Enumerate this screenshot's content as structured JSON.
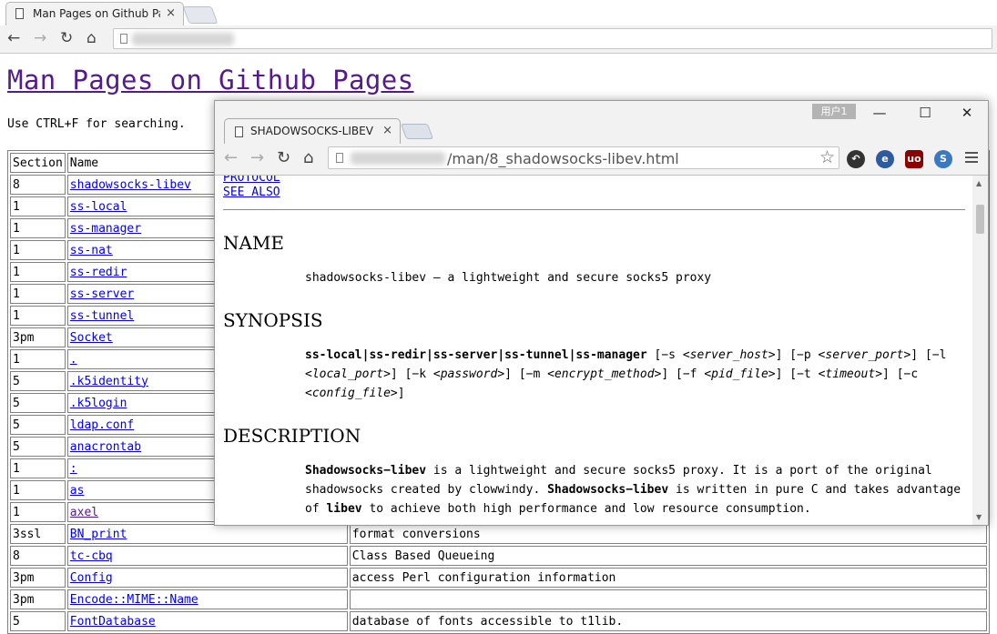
{
  "back_browser": {
    "tab_title": "Man Pages on Github Pa",
    "tab_close": "×",
    "nav": {
      "back": "←",
      "forward": "→",
      "reload": "↻",
      "home": "⌂"
    }
  },
  "page": {
    "title": "Man Pages on Github Pages",
    "hint": "Use CTRL+F for searching.",
    "table_header": {
      "section": "Section",
      "name": "Name",
      "desc": ""
    },
    "rows": [
      {
        "section": "8",
        "name": "shadowsocks-libev",
        "desc": "",
        "visited": false
      },
      {
        "section": "1",
        "name": "ss-local",
        "desc": "",
        "visited": false
      },
      {
        "section": "1",
        "name": "ss-manager",
        "desc": "",
        "visited": false
      },
      {
        "section": "1",
        "name": "ss-nat",
        "desc": "",
        "visited": false
      },
      {
        "section": "1",
        "name": "ss-redir",
        "desc": "",
        "visited": false
      },
      {
        "section": "1",
        "name": "ss-server",
        "desc": "",
        "visited": false
      },
      {
        "section": "1",
        "name": "ss-tunnel",
        "desc": "",
        "visited": false
      },
      {
        "section": "3pm",
        "name": "Socket",
        "desc": "",
        "visited": false
      },
      {
        "section": "1",
        "name": ".",
        "desc": "",
        "visited": false
      },
      {
        "section": "5",
        "name": ".k5identity",
        "desc": "",
        "visited": false
      },
      {
        "section": "5",
        "name": ".k5login",
        "desc": "",
        "visited": false
      },
      {
        "section": "5",
        "name": "ldap.conf",
        "desc": "",
        "visited": false
      },
      {
        "section": "5",
        "name": "anacrontab",
        "desc": "",
        "visited": false
      },
      {
        "section": "1",
        "name": ":",
        "desc": "",
        "visited": false
      },
      {
        "section": "1",
        "name": "as",
        "desc": "",
        "visited": false
      },
      {
        "section": "1",
        "name": "axel",
        "desc": "",
        "visited": true
      },
      {
        "section": "3ssl",
        "name": "BN_print",
        "desc": "format conversions",
        "visited": false
      },
      {
        "section": "8",
        "name": "tc-cbq",
        "desc": "Class Based Queueing",
        "visited": false
      },
      {
        "section": "3pm",
        "name": "Config",
        "desc": "access Perl configuration information",
        "visited": false
      },
      {
        "section": "3pm",
        "name": "Encode::MIME::Name",
        "desc": "",
        "visited": false
      },
      {
        "section": "5",
        "name": "FontDatabase",
        "desc": "database of fonts accessible to t1lib.",
        "visited": false
      }
    ]
  },
  "popup": {
    "user_badge": "用户1",
    "window_controls": {
      "minimize": "—",
      "maximize": "☐",
      "close": "✕"
    },
    "tab_title": "SHADOWSOCKS-LIBEV",
    "tab_close": "×",
    "url_path": "/man/8_shadowsocks-libev.html",
    "star": "☆",
    "extensions": [
      {
        "name": "history-extension-icon",
        "glyph": "↶",
        "color": "#333333"
      },
      {
        "name": "e-extension-icon",
        "glyph": "e",
        "color": "#2d5aa0"
      },
      {
        "name": "ublock-extension-icon",
        "glyph": "uo",
        "color": "#8b0000"
      },
      {
        "name": "translate-extension-icon",
        "glyph": "S",
        "color": "#3a78c4"
      }
    ],
    "content": {
      "links": [
        "PROTOCOL",
        "SEE ALSO"
      ],
      "name_heading": "NAME",
      "name_text": "shadowsocks-libev — a lightweight and secure socks5 proxy",
      "synopsis_heading": "SYNOPSIS",
      "synopsis": {
        "cmd": "ss-local|ss-redir|ss-server|ss-tunnel|ss-manager",
        "o1": " [−s ",
        "a1": "<server_host>",
        "o2": "] [−p ",
        "a2": "<server_port>",
        "o3": "] [−l ",
        "a3": "<local_port>",
        "o4": "] [−k ",
        "a4": "<password>",
        "o5": "] [−m ",
        "a5": "<encrypt_method>",
        "o6": "] [−f ",
        "a6": "<pid_file>",
        "o7": "] [−t ",
        "a7": "<timeout>",
        "o8": "] [−c ",
        "a8": "<config_file>",
        "o9": "]"
      },
      "description_heading": "DESCRIPTION",
      "description": {
        "b1": "Shadowsocks−libev",
        "t1": " is a lightweight and secure socks5 proxy. It is a port of the original shadowsocks created by clowwindy. ",
        "b2": "Shadowsocks−libev",
        "t2": " is written in pure C and takes advantage of ",
        "b3": "libev",
        "t3": " to achieve both high performance and low resource consumption."
      }
    }
  }
}
